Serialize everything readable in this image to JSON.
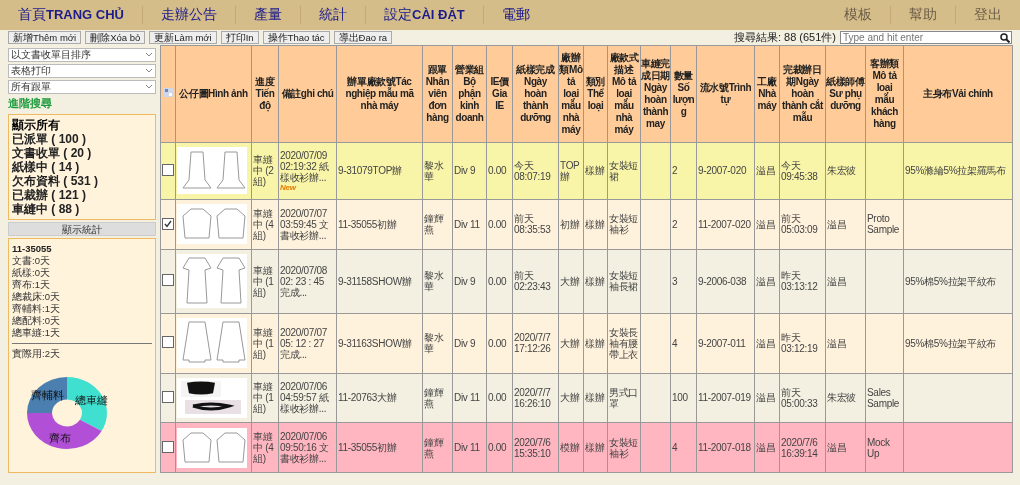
{
  "nav": {
    "left": [
      {
        "label": "首頁**TRANG CHỦ**"
      },
      {
        "label": "走辦公告"
      },
      {
        "label": "產量"
      },
      {
        "label": "統計"
      },
      {
        "label": "設定**CÀI ĐẶT**"
      },
      {
        "label": "電郵"
      }
    ],
    "right": [
      {
        "label": "模板"
      },
      {
        "label": "幫助"
      },
      {
        "label": "登出"
      }
    ]
  },
  "toolbar": {
    "buttons": [
      "新增Thêm mới",
      "刪除Xóa bỏ",
      "更新Làm mới",
      "打印In",
      "操作Thao tác",
      "導出Đao ra"
    ],
    "result": "搜尋結果: 88 (651件)",
    "search": {
      "placeholder": "Type and hit enter"
    }
  },
  "sidebar": {
    "selects": [
      "以文書收單目排序",
      "表格打印",
      "所有跟單"
    ],
    "advanced_link": "進階搜尋",
    "filters": [
      {
        "label": "顯示所有",
        "selected": true
      },
      {
        "label": "已派單 ( 100 )",
        "selected": false
      },
      {
        "label": "文書收單 ( 20 )",
        "selected": false
      },
      {
        "label": "紙樣中 ( 14 )",
        "selected": false
      },
      {
        "label": "欠布資料 ( 531 )",
        "selected": false
      },
      {
        "label": "已裁辦 ( 121 )",
        "selected": false
      },
      {
        "label": "車縫中 ( 88 )",
        "selected": false
      }
    ],
    "stats_button": "顯示統計",
    "stats": {
      "title": "11-35055",
      "lines": [
        "文書:0天",
        "紙樣:0天",
        "齊布:1天",
        "總裁床:0天",
        "齊輔料:1天",
        "總配料:0天",
        "總車縫:1天"
      ],
      "total": "實際用:2天",
      "slices": [
        {
          "label": "齊輔料",
          "color": "#4a7fb0"
        },
        {
          "label": "總車縫",
          "color": "#40e0d0"
        },
        {
          "label": "齊布",
          "color": "#b14fd6"
        }
      ]
    }
  },
  "table": {
    "columns": [
      "公仔圖Hình ảnh",
      "進度Tiến độ",
      "備註ghi chú",
      "辦單廠款號Tác nghiệp mẫu mã nhà máy",
      "跟單Nhân viên đơn hàng",
      "營業組Bộ phận kinh doanh",
      "IE價Gia IE",
      "紙樣完成Ngày hoàn thành dưỡng",
      "廠辦類Mô tả loại mẫu nhà máy",
      "類別Thể loại",
      "廠款式描述Mô tả loại mẫu nhà máy",
      "車縫完成日期Ngày hoàn thành may",
      "數量Số lượng",
      "流水號Trình tự",
      "工廠Nhà máy",
      "完裁辦日期Ngày hoàn thành cắt mẫu",
      "紙樣師傅Sư phụ dưỡng",
      "客辦類Mô tả loại mẫu khách hàng",
      "主身布Vải chính"
    ],
    "rows": [
      {
        "checked": false,
        "color": "#f9f5a8",
        "progress": "車縫中 (2組)",
        "remarks": "2020/07/09 02:19:32 紙樣收衫辦...",
        "badge": "New",
        "style_no": "9-31079TOP辦",
        "staff": "黎水華",
        "division": "Div 9",
        "ie": "0.00",
        "paper_date": "今天 08:07:19",
        "sample_type": "TOP辦",
        "category": "樣辦",
        "description": "女裝短裙",
        "qty": "2",
        "serial": "9-2007-020",
        "factory": "溢昌",
        "cut_date": "今天 09:45:38",
        "master": "朱宏彼",
        "fabric": "95%滌綸5%拉架羅馬布"
      },
      {
        "checked": true,
        "color": "#fff2dc",
        "progress": "車縫中 (4組)",
        "remarks": "2020/07/07 03:59:45 文書收衫辦...",
        "style_no": "11-35055初辦",
        "staff": "鐘輝燕",
        "division": "Div 11",
        "ie": "0.00",
        "paper_date": "前天 08:35:53",
        "sample_type": "初辦",
        "category": "樣辦",
        "description": "女裝短袖衫",
        "qty": "2",
        "serial": "11-2007-020",
        "factory": "溢昌",
        "cut_date": "前天 05:03:09",
        "master": "溢昌",
        "customer": "Proto Sample"
      },
      {
        "checked": false,
        "color": "#f3f0e1",
        "progress": "車縫中 (1組)",
        "remarks": "2020/07/08 02: 23 : 45 完成...",
        "style_no": "9-31158SHOW辦",
        "staff": "黎水華",
        "division": "Div 9",
        "ie": "0.00",
        "paper_date": "前天 02:23:43",
        "sample_type": "大辦",
        "category": "樣辦",
        "description": "女裝短袖長裙",
        "qty": "3",
        "serial": "9-2006-038",
        "factory": "溢昌",
        "cut_date": "昨天 03:13:12",
        "master": "溢昌",
        "fabric": "95%棉5%拉架平紋布"
      },
      {
        "checked": false,
        "color": "#fff2dc",
        "progress": "車縫中 (1組)",
        "remarks": "2020/07/07 05: 12 : 27 完成...",
        "style_no": "9-31163SHOW辦",
        "staff": "黎水華",
        "division": "Div 9",
        "ie": "0.00",
        "paper_date": "2020/7/7 17:12:26",
        "sample_type": "大辦",
        "category": "樣辦",
        "description": "女裝長袖有腰帶上衣",
        "qty": "4",
        "serial": "9-2007-011",
        "factory": "溢昌",
        "cut_date": "昨天 03:12:19",
        "master": "溢昌",
        "fabric": "95%棉5%拉架平紋布"
      },
      {
        "checked": false,
        "color": "#f3f0e1",
        "progress": "車縫中 (1組)",
        "remarks": "2020/07/06 04:59:57 紙樣收衫辦...",
        "style_no": "11-20763大辦",
        "staff": "鐘輝燕",
        "division": "Div 11",
        "ie": "0.00",
        "paper_date": "2020/7/7 16:26:10",
        "sample_type": "大辦",
        "category": "樣辦",
        "description": "男式口罩",
        "qty": "100",
        "serial": "11-2007-019",
        "factory": "溢昌",
        "cut_date": "前天 05:00:33",
        "master": "朱宏彼",
        "customer": "Sales Sample"
      },
      {
        "checked": false,
        "color": "#ffb6c1",
        "progress": "車縫中 (4組)",
        "remarks": "2020/07/06 09:50:16 文書收衫辦...",
        "style_no": "11-35055初辦",
        "staff": "鐘輝燕",
        "division": "Div 11",
        "ie": "0.00",
        "paper_date": "2020/7/6 15:35:10",
        "sample_type": "模辦",
        "category": "樣辦",
        "description": "女裝短袖衫",
        "qty": "4",
        "serial": "11-2007-018",
        "factory": "溢昌",
        "cut_date": "2020/7/6 16:39:14",
        "master": "溢昌",
        "customer": "Mock Up"
      }
    ]
  }
}
